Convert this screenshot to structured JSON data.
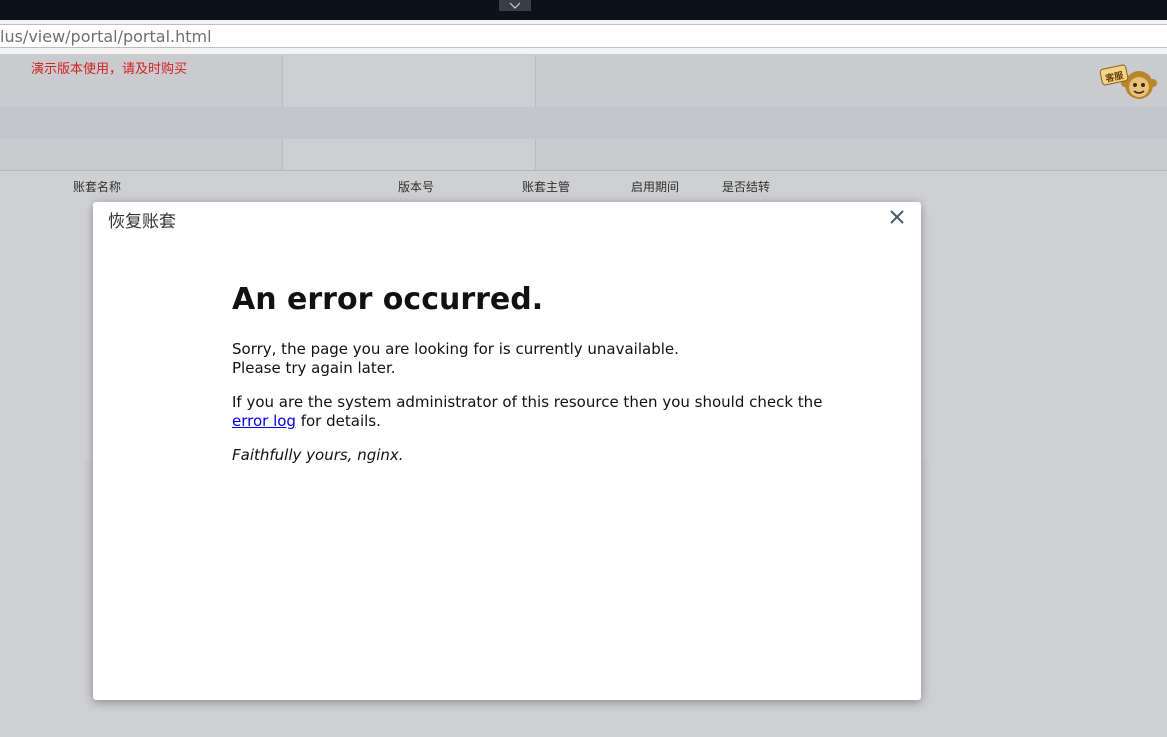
{
  "browser": {
    "url": "lus/view/portal/portal.html"
  },
  "app": {
    "demo_notice": "演示版本使用，请及时购买",
    "mascot_label": "客服"
  },
  "table": {
    "columns": [
      "账套名称",
      "版本号",
      "账套主管",
      "启用期间",
      "是否结转"
    ]
  },
  "dialog": {
    "title": "恢复账套",
    "heading": "An error occurred.",
    "line1": "Sorry, the page you are looking for is currently unavailable.",
    "line2": "Please try again later.",
    "admin_text": "If you are the system administrator of this resource then you should check the",
    "link_text": "error log",
    "after_link": " for details.",
    "signature": "Faithfully yours, nginx."
  },
  "colors": {
    "notice": "#d42020",
    "link": "#0000ee",
    "topbar": "#0d111b"
  },
  "icons": {
    "topbar_toggle": "chevron-down-icon",
    "close": "close-icon",
    "mascot": "monkey-mascot-icon"
  }
}
